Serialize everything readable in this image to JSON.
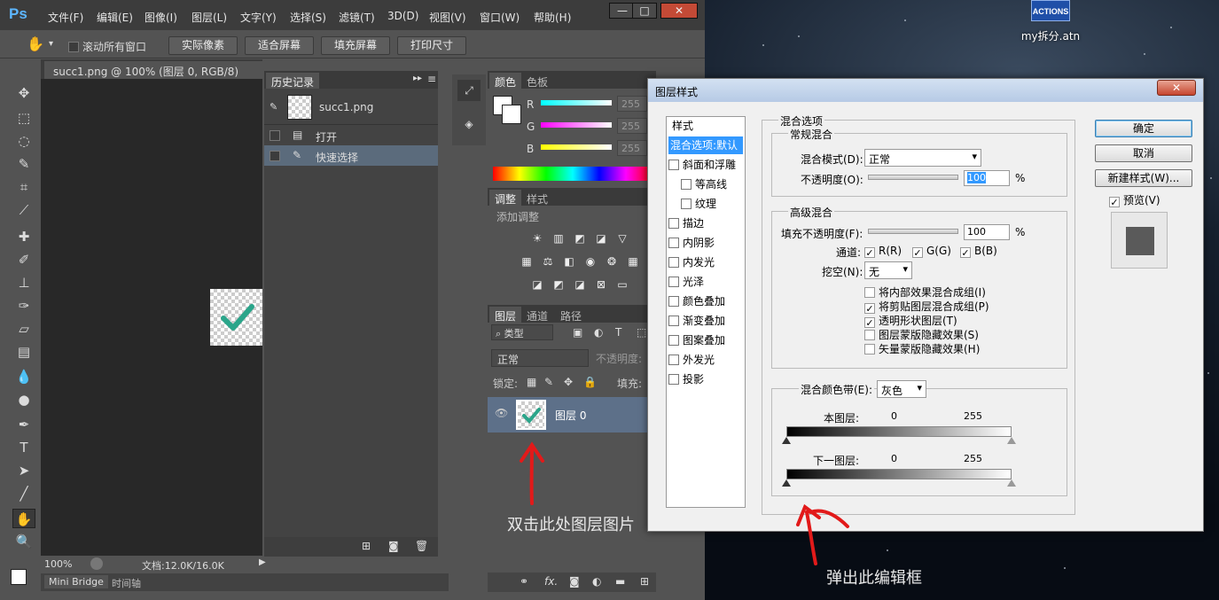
{
  "desktop": {
    "file_icon_badge": "ACTIONS",
    "file_label": "my拆分.atn"
  },
  "photoshop": {
    "logo": "Ps",
    "menu": [
      "文件(F)",
      "编辑(E)",
      "图像(I)",
      "图层(L)",
      "文字(Y)",
      "选择(S)",
      "滤镜(T)",
      "3D(D)",
      "视图(V)",
      "窗口(W)",
      "帮助(H)"
    ],
    "window_controls": [
      "—",
      "□",
      "✕"
    ],
    "options": {
      "scroll_all": "滚动所有窗口",
      "buttons": [
        "实际像素",
        "适合屏幕",
        "填充屏幕",
        "打印尺寸"
      ]
    },
    "document_tab": "succ1.png @ 100% (图层 0, RGB/8)",
    "status": {
      "zoom": "100%",
      "doc_info": "文档:12.0K/16.0K"
    },
    "bottom_tabs": [
      "Mini Bridge",
      "时间轴"
    ],
    "history": {
      "title": "历史记录",
      "snapshot": "succ1.png",
      "items": [
        "打开",
        "快速选择"
      ]
    },
    "color_panel": {
      "tabs": [
        "颜色",
        "色板"
      ],
      "channels": [
        {
          "label": "R",
          "value": "255"
        },
        {
          "label": "G",
          "value": "255"
        },
        {
          "label": "B",
          "value": "255"
        }
      ]
    },
    "adjust_panel": {
      "tabs": [
        "调整",
        "样式"
      ],
      "hint": "添加调整"
    },
    "layers_panel": {
      "tabs": [
        "图层",
        "通道",
        "路径"
      ],
      "filter": "类型",
      "blend_mode": "正常",
      "opacity_label": "不透明度:",
      "lock_label": "锁定:",
      "fill_label": "填充:",
      "layer_name": "图层 0",
      "fx": "fx."
    }
  },
  "dialog": {
    "title": "图层样式",
    "close": "✕",
    "style_list": {
      "header": "样式",
      "items": [
        {
          "label": "混合选项:默认",
          "selected": true,
          "checkbox": false,
          "indent": false
        },
        {
          "label": "斜面和浮雕",
          "checkbox": true,
          "indent": false
        },
        {
          "label": "等高线",
          "checkbox": true,
          "indent": true
        },
        {
          "label": "纹理",
          "checkbox": true,
          "indent": true
        },
        {
          "label": "描边",
          "checkbox": true,
          "indent": false
        },
        {
          "label": "内阴影",
          "checkbox": true,
          "indent": false
        },
        {
          "label": "内发光",
          "checkbox": true,
          "indent": false
        },
        {
          "label": "光泽",
          "checkbox": true,
          "indent": false
        },
        {
          "label": "颜色叠加",
          "checkbox": true,
          "indent": false
        },
        {
          "label": "渐变叠加",
          "checkbox": true,
          "indent": false
        },
        {
          "label": "图案叠加",
          "checkbox": true,
          "indent": false
        },
        {
          "label": "外发光",
          "checkbox": true,
          "indent": false
        },
        {
          "label": "投影",
          "checkbox": true,
          "indent": false
        }
      ]
    },
    "blend": {
      "section": "混合选项",
      "general": "常规混合",
      "blend_mode_label": "混合模式(D):",
      "blend_mode_value": "正常",
      "opacity_label": "不透明度(O):",
      "opacity_value": "100",
      "percent": "%",
      "advanced": "高级混合",
      "fill_opacity_label": "填充不透明度(F):",
      "fill_opacity_value": "100",
      "channels_label": "通道:",
      "channels": [
        "R(R)",
        "G(G)",
        "B(B)"
      ],
      "knockout_label": "挖空(N):",
      "knockout_value": "无",
      "options": [
        {
          "label": "将内部效果混合成组(I)",
          "checked": false
        },
        {
          "label": "将剪贴图层混合成组(P)",
          "checked": true
        },
        {
          "label": "透明形状图层(T)",
          "checked": true
        },
        {
          "label": "图层蒙版隐藏效果(S)",
          "checked": false
        },
        {
          "label": "矢量蒙版隐藏效果(H)",
          "checked": false
        }
      ],
      "blend_if_label": "混合颜色带(E):",
      "blend_if_value": "灰色",
      "this_layer_label": "本图层:",
      "underlying_label": "下一图层:",
      "range_min": "0",
      "range_max": "255"
    },
    "buttons": {
      "ok": "确定",
      "cancel": "取消",
      "new_style": "新建样式(W)...",
      "preview": "预览(V)"
    }
  },
  "annotations": {
    "double_click": "双击此处图层图片",
    "popup": "弹出此编辑框"
  }
}
